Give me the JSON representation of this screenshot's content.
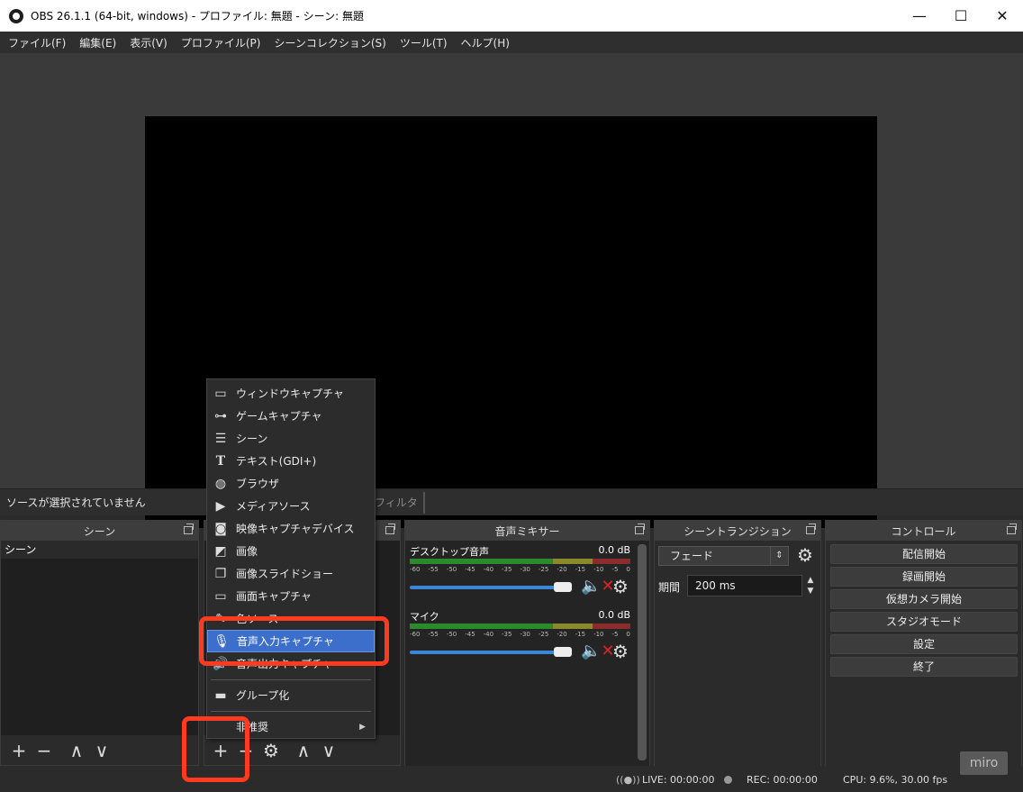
{
  "window": {
    "title": "OBS 26.1.1 (64-bit, windows) - プロファイル: 無題 - シーン: 無題",
    "minimize_glyph": "—",
    "maximize_glyph": "☐",
    "close_glyph": "✕"
  },
  "menubar": [
    "ファイル(F)",
    "編集(E)",
    "表示(V)",
    "プロファイル(P)",
    "シーンコレクション(S)",
    "ツール(T)",
    "ヘルプ(H)"
  ],
  "source_bar": {
    "no_source_text": "ソースが選択されていません",
    "filter_label": "フィルタ"
  },
  "scenes": {
    "title": "シーン",
    "items": [
      "シーン"
    ],
    "toolbar": [
      "+",
      "−",
      "∧",
      "∨"
    ]
  },
  "sources_toolbar": [
    "+",
    "−",
    "⚙",
    "∧",
    "∨"
  ],
  "mixer": {
    "title": "音声ミキサー",
    "channels": [
      {
        "name": "デスクトップ音声",
        "db": "0.0 dB"
      },
      {
        "name": "マイク",
        "db": "0.0 dB"
      }
    ],
    "ticks": [
      "-60",
      "-55",
      "-50",
      "-45",
      "-40",
      "-35",
      "-30",
      "-25",
      "-20",
      "-15",
      "-10",
      "-5",
      "0"
    ]
  },
  "transitions": {
    "title": "シーントランジション",
    "selected": "フェード",
    "duration_label": "期間",
    "duration_value": "200 ms"
  },
  "controls": {
    "title": "コントロール",
    "buttons": [
      "配信開始",
      "録画開始",
      "仮想カメラ開始",
      "スタジオモード",
      "設定",
      "終了"
    ]
  },
  "context_menu": {
    "items": [
      {
        "label": "ウィンドウキャプチャ",
        "icon": "window-icon"
      },
      {
        "label": "ゲームキャプチャ",
        "icon": "gamepad-icon"
      },
      {
        "label": "シーン",
        "icon": "list-icon"
      },
      {
        "label": "テキスト(GDI+)",
        "icon": "text-icon"
      },
      {
        "label": "ブラウザ",
        "icon": "globe-icon"
      },
      {
        "label": "メディアソース",
        "icon": "play-icon"
      },
      {
        "label": "映像キャプチャデバイス",
        "icon": "camera-icon"
      },
      {
        "label": "画像",
        "icon": "image-icon"
      },
      {
        "label": "画像スライドショー",
        "icon": "slideshow-icon"
      },
      {
        "label": "画面キャプチャ",
        "icon": "monitor-icon"
      },
      {
        "label": "色ソース",
        "icon": "brush-icon"
      },
      {
        "label": "音声入力キャプチャ",
        "icon": "microphone-icon"
      },
      {
        "label": "音声出力キャプチャ",
        "icon": "speaker-icon"
      },
      {
        "label": "グループ化",
        "icon": "folder-icon"
      },
      {
        "label": "非推奨",
        "icon": "none"
      }
    ]
  },
  "status": {
    "live": "LIVE: 00:00:00",
    "rec": "REC: 00:00:00",
    "cpu": "CPU: 9.6%, 30.00 fps"
  },
  "watermark": "miro",
  "colors": {
    "highlight": "#ff3b1f",
    "menu_active": "#3c6fcc",
    "volume": "#3b86d6",
    "mute": "#dd2222"
  }
}
